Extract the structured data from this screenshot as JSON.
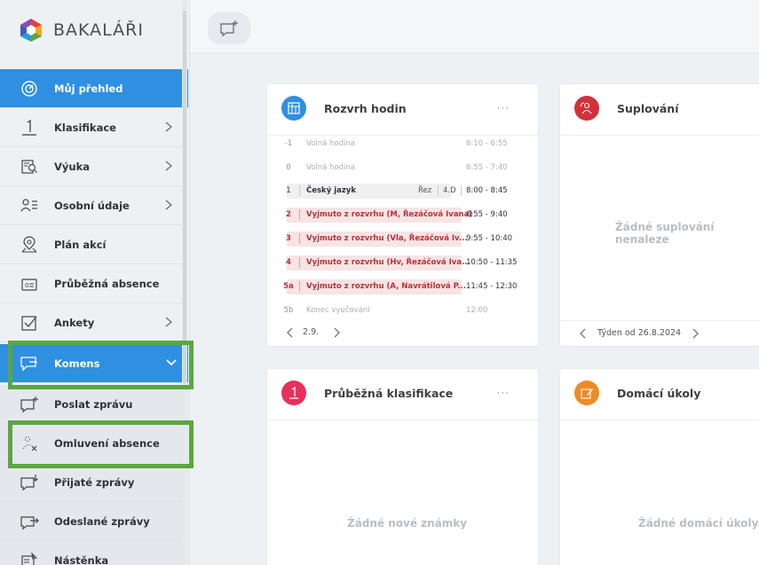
{
  "app": {
    "name": "BAKALÁŘI"
  },
  "colors": {
    "accent": "#2f8fe0",
    "highlight": "#5aa741",
    "red": "#b8323a"
  },
  "sidebar": {
    "items": [
      {
        "label": "Můj přehled",
        "icon": "gauge-icon",
        "active": true
      },
      {
        "label": "Klasifikace",
        "icon": "grade-icon",
        "chevron": true
      },
      {
        "label": "Výuka",
        "icon": "book-search-icon",
        "chevron": true
      },
      {
        "label": "Osobní údaje",
        "icon": "person-list-icon",
        "chevron": true
      },
      {
        "label": "Plán akcí",
        "icon": "map-pin-icon"
      },
      {
        "label": "Průběžná absence",
        "icon": "absence-icon"
      },
      {
        "label": "Ankety",
        "icon": "checkbox-icon",
        "chevron": true
      },
      {
        "label": "Komens",
        "icon": "chat-icon",
        "active": true,
        "chevron_down": true
      },
      {
        "label": "Poslat zprávu",
        "icon": "message-plus-icon"
      },
      {
        "label": "Omluvení absence",
        "icon": "person-x-icon"
      },
      {
        "label": "Přijaté zprávy",
        "icon": "message-in-icon"
      },
      {
        "label": "Odeslané zprávy",
        "icon": "message-out-icon"
      },
      {
        "label": "Nástěnka",
        "icon": "board-icon"
      }
    ]
  },
  "cards": {
    "rozvrh": {
      "title": "Rozvrh hodin",
      "dots": "···",
      "rows": [
        {
          "num": "-1",
          "subject": "Volná hodina",
          "time": "6:10 - 6:55"
        },
        {
          "num": "0",
          "subject": "Volná hodina",
          "time": "6:55 - 7:40"
        },
        {
          "num": "1",
          "subject": "Český jazyk",
          "room": "Řez",
          "cls": "4.D",
          "time": "8:00 - 8:45"
        },
        {
          "num": "2",
          "subject": "Vyjmuto z rozvrhu (M, Řezáčová Ivana)",
          "time": "8:55 - 9:40"
        },
        {
          "num": "3",
          "subject": "Vyjmuto z rozvrhu (Vla, Řezáčová Iv...",
          "time": "9:55 - 10:40"
        },
        {
          "num": "4",
          "subject": "Vyjmuto z rozvrhu (Hv, Řezáčová Iva...",
          "time": "10:50 - 11:35"
        },
        {
          "num": "5a",
          "subject": "Vyjmuto z rozvrhu (A, Navrátilová P...",
          "time": "11:45 - 12:30"
        },
        {
          "num": "5b",
          "subject": "Konec vyučování",
          "time": "12:00"
        }
      ],
      "footer_date": "2.9."
    },
    "suplovani": {
      "title": "Suplování",
      "empty": "Žádné suplování nenaleze",
      "footer": "Týden od 26.8.2024"
    },
    "klasifikace": {
      "title": "Průběžná klasifikace",
      "dots": "···",
      "empty": "Žádné nové známky"
    },
    "ukoly": {
      "title": "Domácí úkoly",
      "empty": "Žádné domácí úkoly."
    }
  }
}
